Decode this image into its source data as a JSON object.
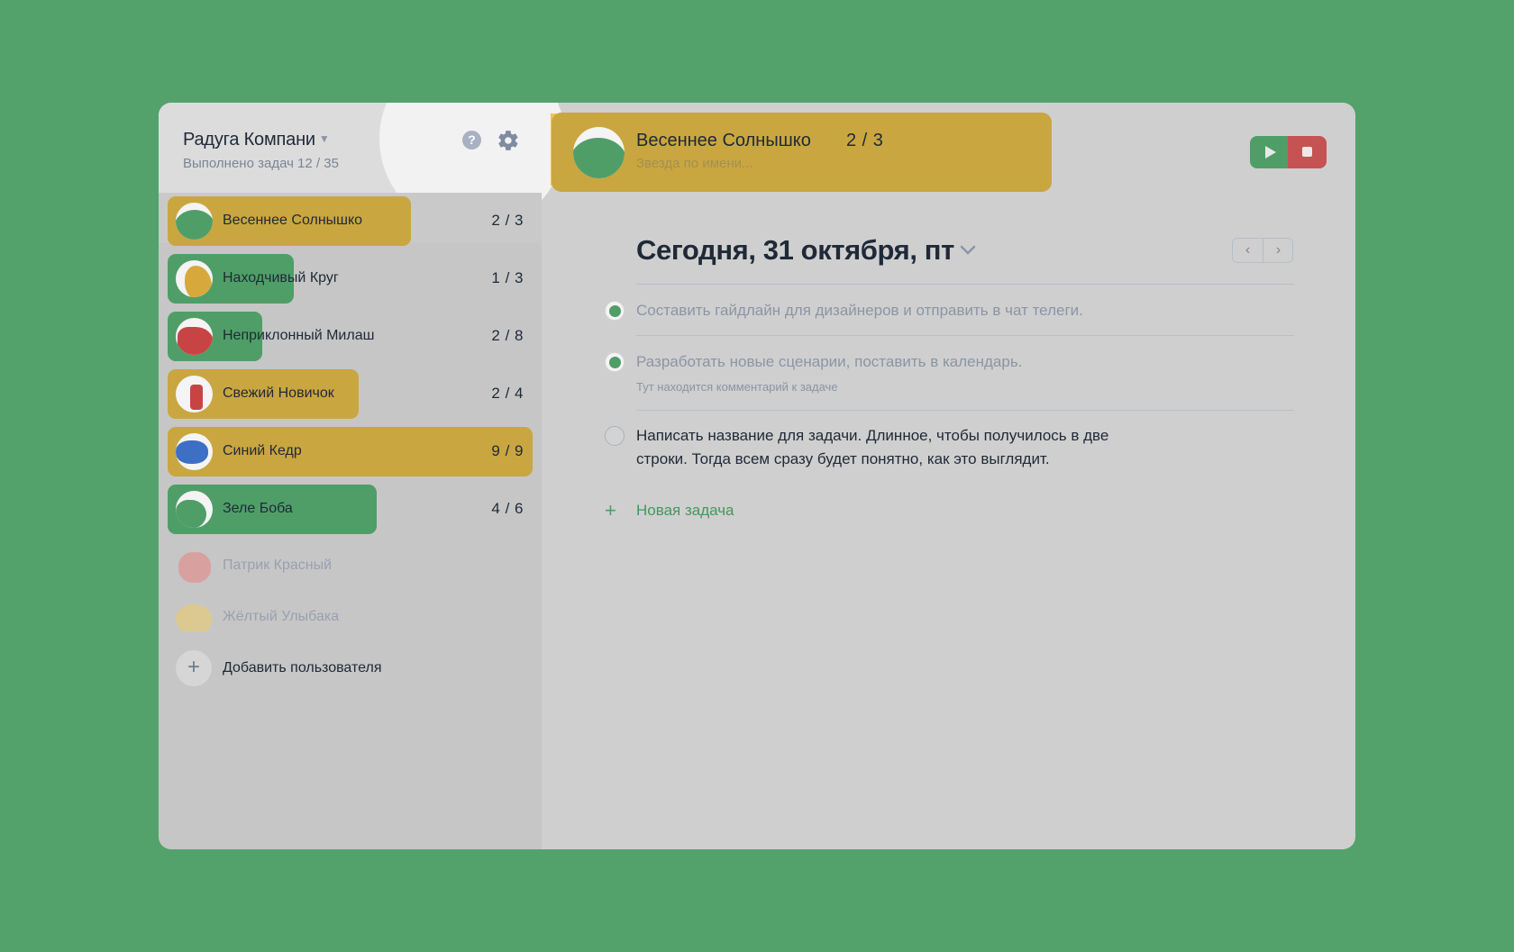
{
  "sidebar": {
    "team_name": "Радуга Компани",
    "team_progress": "Выполнено задач 12 / 35",
    "help_icon": "?",
    "users": [
      {
        "name": "Весеннее Солнышко",
        "count": "2 / 3",
        "color": "#c9a640"
      },
      {
        "name": "Находчивый Круг",
        "count": "1 / 3",
        "color": "#4f9e67"
      },
      {
        "name": "Неприклонный Милаш",
        "count": "2 / 8",
        "color": "#4f9e67"
      },
      {
        "name": "Свежий Новичок",
        "count": "2 / 4",
        "color": "#c9a640"
      },
      {
        "name": "Синий Кедр",
        "count": "9 / 9",
        "color": "#c9a640"
      },
      {
        "name": "Зеле Боба",
        "count": "4 / 6",
        "color": "#4f9e67"
      }
    ],
    "inactive_users": [
      {
        "name": "Патрик Красный"
      },
      {
        "name": "Жёлтый Улыбака"
      }
    ],
    "add_user_label": "Добавить пользователя",
    "add_user_icon": "+"
  },
  "owner": {
    "name": "Весеннее Солнышко",
    "count": "2 / 3",
    "subtitle": "Звезда по имени..."
  },
  "day": {
    "title": "Сегодня, 31 октября, пт",
    "prev": "‹",
    "next": "›"
  },
  "tasks": [
    {
      "text": "Составить гайдлайн для дизайнеров и отправить в чат телеги.",
      "done": true,
      "comment": ""
    },
    {
      "text": "Разработать новые сценарии, поставить в календарь.",
      "done": true,
      "comment": "Тут находится комментарий к задаче"
    },
    {
      "text": "Написать название для задачи. Длинное, чтобы получилось в две строки. Тогда всем сразу будет понятно, как это выглядит.",
      "done": false,
      "comment": ""
    }
  ],
  "new_task": {
    "icon": "+",
    "label": "Новая задача"
  },
  "colors": {
    "background": "#53a26b",
    "accent_green": "#4f9e67",
    "accent_yellow": "#c9a640",
    "accent_red": "#c55353"
  }
}
